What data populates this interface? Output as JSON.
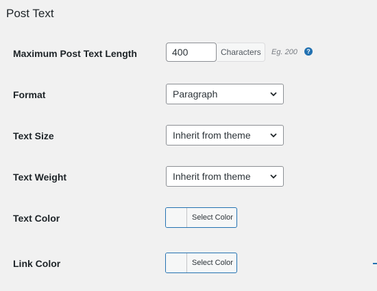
{
  "section": {
    "title": "Post Text"
  },
  "rows": {
    "max_length": {
      "label": "Maximum Post Text Length",
      "value": "400",
      "unit": "Characters",
      "hint": "Eg. 200",
      "help_icon": "question-circle-icon"
    },
    "format": {
      "label": "Format",
      "selected": "Paragraph"
    },
    "text_size": {
      "label": "Text Size",
      "selected": "Inherit from theme"
    },
    "text_weight": {
      "label": "Text Weight",
      "selected": "Inherit from theme"
    },
    "text_color": {
      "label": "Text Color",
      "button": "Select Color"
    },
    "link_color": {
      "label": "Link Color",
      "button": "Select Color"
    }
  },
  "colors": {
    "accent": "#2271b1",
    "background": "#f1f1f1",
    "text": "#1d2327"
  }
}
